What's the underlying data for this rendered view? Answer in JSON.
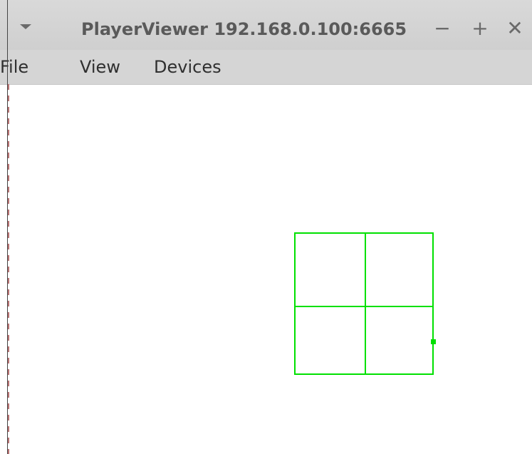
{
  "window": {
    "title": "PlayerViewer 192.168.0.100:6665",
    "controls": {
      "menu_icon": "triangle-down",
      "minimize_icon": "minus",
      "maximize_icon": "plus",
      "close_icon": "x"
    }
  },
  "menubar": {
    "items": [
      {
        "label": "File"
      },
      {
        "label": "View"
      },
      {
        "label": "Devices"
      }
    ]
  },
  "colors": {
    "title_bar": "#d5d5d5",
    "title_text": "#5a5a5a",
    "grid_line": "#00e000",
    "background": "#ffffff"
  },
  "viewer": {
    "grid": {
      "columns": 2,
      "rows": 2
    },
    "marker": "position-dot"
  }
}
